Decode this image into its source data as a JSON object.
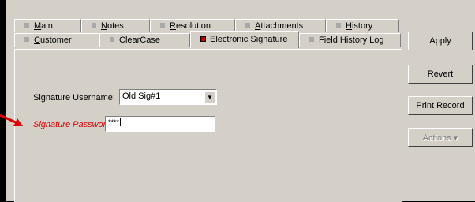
{
  "tabs_back": [
    {
      "label": "Main",
      "u": "M",
      "rest": "ain"
    },
    {
      "label": "Notes",
      "u": "N",
      "rest": "otes"
    },
    {
      "label": "Resolution",
      "u": "R",
      "rest": "esolution"
    },
    {
      "label": "Attachments",
      "u": "A",
      "rest": "ttachments"
    },
    {
      "label": "History",
      "u": "H",
      "rest": "istory"
    }
  ],
  "tabs_front": [
    {
      "label": "Customer",
      "u": "C",
      "rest": "ustomer"
    },
    {
      "label": "ClearCase"
    },
    {
      "label": "Electronic Signature",
      "active": true
    },
    {
      "label": "Field History Log"
    }
  ],
  "form": {
    "username_label": "Signature Username:",
    "username_value": "Old Sig#1",
    "password_label": "Signature Password:",
    "password_value": "****"
  },
  "buttons": {
    "apply": "Apply",
    "revert": "Revert",
    "print": "Print Record",
    "actions": "Actions ▾"
  },
  "colors": {
    "highlight_label": "#e00000",
    "arrow": "#e00000"
  }
}
